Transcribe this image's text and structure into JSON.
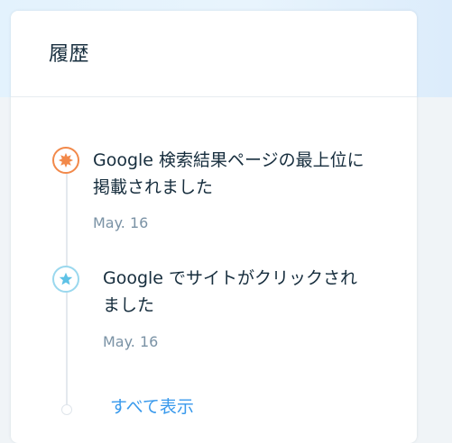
{
  "card": {
    "title": "履歴"
  },
  "events": [
    {
      "line1": "Google 検索結果ページの最上位に",
      "line2": "掲載されました",
      "date": "May. 16",
      "icon": "burst-icon"
    },
    {
      "line1": "Google でサイトがクリックされ",
      "line2": "ました",
      "date": "May. 16",
      "icon": "star-icon"
    }
  ],
  "show_all_label": "すべて表示",
  "colors": {
    "title_text": "#162d3d",
    "date_text": "#7a92a5",
    "link": "#3899ec",
    "burst_icon": "#f2894a",
    "star_icon": "#5ec2e6",
    "star_border": "#9ad8ee"
  }
}
